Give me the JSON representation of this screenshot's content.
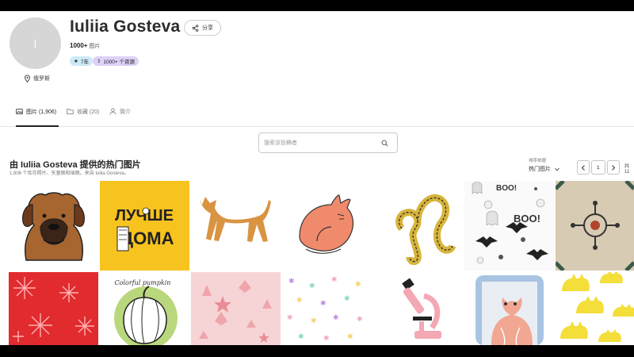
{
  "profile": {
    "avatar_initial": "I",
    "name": "Iuliia Gosteva",
    "share_label": "分享",
    "count_value": "1000+",
    "count_label": "图片",
    "badge_years": "7年",
    "badge_resources": "1000+ 个资源",
    "location": "俄罗斯"
  },
  "tabs": [
    {
      "label": "图片 (1,906)",
      "icon": "image-icon",
      "active": true
    },
    {
      "label": "收藏 (20)",
      "icon": "folder-icon",
      "active": false
    },
    {
      "label": "简介",
      "icon": "person-icon",
      "active": false
    }
  ],
  "search": {
    "placeholder": "搜索该投稿者",
    "value": ""
  },
  "section": {
    "title": "由 Iuliia Gosteva 提供的热门图片",
    "subtitle": "1,906 个库存照片、矢量图和插图。来自 Iuliia Gosteva。"
  },
  "sort": {
    "label": "排序依据",
    "selected": "热门图片"
  },
  "pagination": {
    "current_page": "1",
    "total_label": "共 11"
  },
  "gallery": [
    {
      "subject": "mastiff-dog-portrait"
    },
    {
      "subject": "lettering-card",
      "text_line1": "ЛУЧШЕ",
      "text_line2": "ДОМА"
    },
    {
      "subject": "walking-dog"
    },
    {
      "subject": "sleeping-cat"
    },
    {
      "subject": "leo-zodiac-sign"
    },
    {
      "subject": "halloween-pattern",
      "text": "BOO!"
    },
    {
      "subject": "ornamental-tile"
    },
    {
      "subject": "red-snowflake-pattern"
    },
    {
      "subject": "pumpkin-drawing",
      "text": "Colorful pumpkin"
    },
    {
      "subject": "pink-seashell-pattern"
    },
    {
      "subject": "confetti-pattern"
    },
    {
      "subject": "microscope"
    },
    {
      "subject": "framed-cat-portrait"
    },
    {
      "subject": "yellow-cats-pattern"
    }
  ],
  "colors": {
    "years_badge": "#cde9f6",
    "resources_badge": "#ded0f7",
    "accent_yellow": "#f7c31f"
  }
}
